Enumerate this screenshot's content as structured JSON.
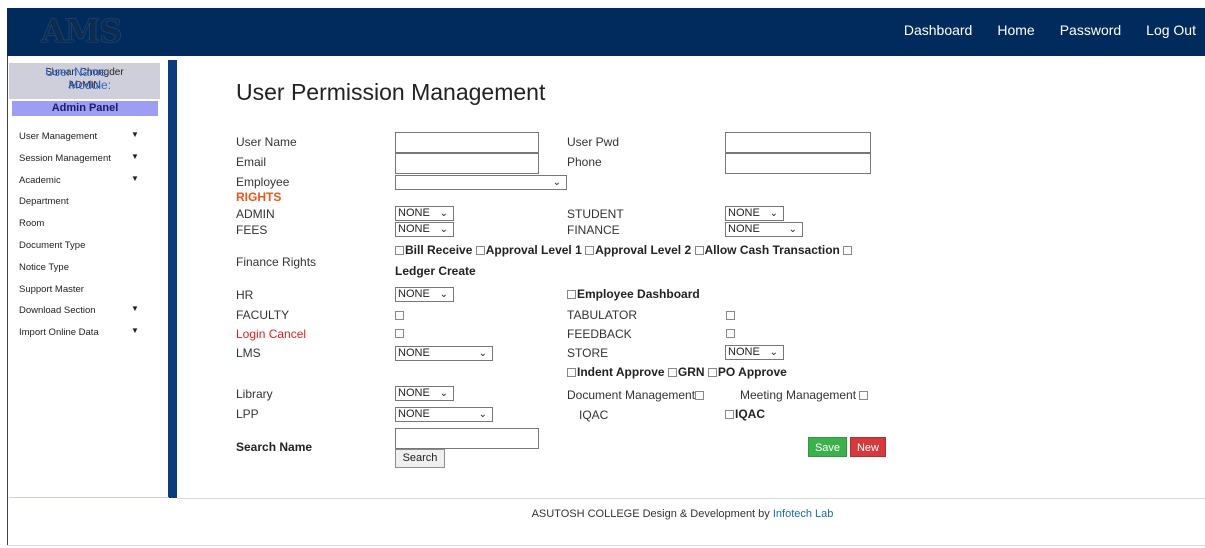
{
  "header": {
    "logo": "AMS",
    "nav": [
      "Dashboard",
      "Home",
      "Password",
      "Log Out"
    ]
  },
  "sidebar": {
    "user_label": "User Name:",
    "user_name": "Suman Chongder",
    "module_label": "Module:",
    "module": "ADMIN",
    "panel_title": "Admin Panel",
    "items": [
      {
        "label": "User Management",
        "expandable": true
      },
      {
        "label": "Session Management",
        "expandable": true
      },
      {
        "label": "Academic",
        "expandable": true
      },
      {
        "label": "Department",
        "expandable": false
      },
      {
        "label": "Room",
        "expandable": false
      },
      {
        "label": "Document Type",
        "expandable": false
      },
      {
        "label": "Notice Type",
        "expandable": false
      },
      {
        "label": "Support Master",
        "expandable": false
      },
      {
        "label": "Download Section",
        "expandable": true
      },
      {
        "label": "Import Online Data",
        "expandable": true
      }
    ]
  },
  "main": {
    "title": "User Permission Management",
    "labels": {
      "user_name": "User Name",
      "user_pwd": "User Pwd",
      "email": "Email",
      "phone": "Phone",
      "employee": "Employee",
      "rights": "RIGHTS",
      "admin": "ADMIN",
      "student": "STUDENT",
      "fees": "FEES",
      "finance": "FINANCE",
      "finance_rights": "Finance Rights",
      "bill_receive": "Bill Receive",
      "approval_level_1": "Approval Level 1",
      "approval_level_2": "Approval Level 2",
      "allow_cash": "Allow Cash Transaction",
      "ledger_create": "Ledger Create",
      "hr": "HR",
      "employee_dashboard": "Employee Dashboard",
      "faculty": "FACULTY",
      "tabulator": "TABULATOR",
      "login_cancel": "Login Cancel",
      "feedback": "FEEDBACK",
      "lms": "LMS",
      "store": "STORE",
      "indent_approve": "Indent Approve",
      "grn": "GRN",
      "po_approve": "PO Approve",
      "library": "Library",
      "document_management": "Document Management",
      "meeting_management": "Meeting Management",
      "lpp": "LPP",
      "iqac": "IQAC",
      "iqac_cb": "IQAC",
      "search_name": "Search Name"
    },
    "selects": {
      "employee": "",
      "admin": "NONE",
      "student": "NONE",
      "fees": "NONE",
      "finance": "NONE",
      "hr": "NONE",
      "lms": "NONE",
      "store": "NONE",
      "library": "NONE",
      "lpp": "NONE"
    },
    "buttons": {
      "search": "Search",
      "save": "Save",
      "new": "New"
    }
  },
  "footer": {
    "text": "ASUTOSH COLLEGE  Design & Development by",
    "link": "Infotech Lab"
  }
}
